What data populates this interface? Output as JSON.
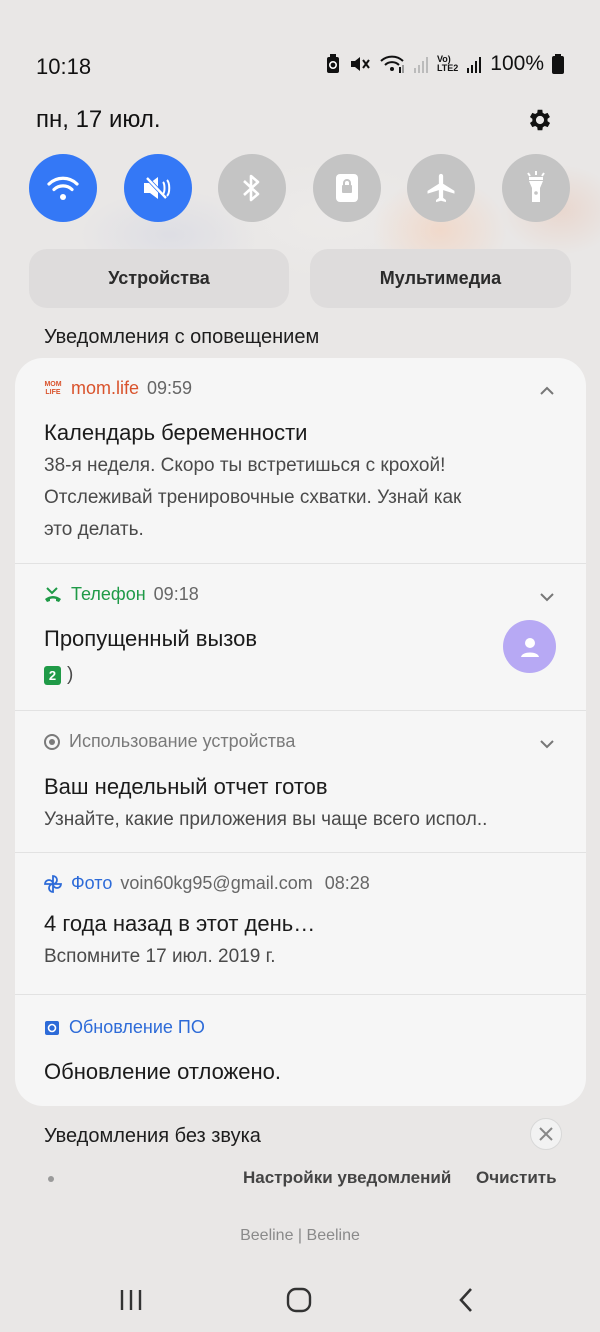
{
  "status_bar": {
    "time": "10:18",
    "battery": "100%",
    "lte_label_top": "Vo)",
    "lte_label_bottom": "LTE2"
  },
  "date": "пн, 17 июл.",
  "quick_toggles": [
    {
      "name": "wifi",
      "state": "on"
    },
    {
      "name": "sound-mute",
      "state": "on"
    },
    {
      "name": "bluetooth",
      "state": "off"
    },
    {
      "name": "rotation-lock",
      "state": "off"
    },
    {
      "name": "airplane-mode",
      "state": "off"
    },
    {
      "name": "flashlight",
      "state": "off"
    }
  ],
  "pills": {
    "devices": "Устройства",
    "media": "Мультимедиа"
  },
  "alerting_section_title": "Уведомления с оповещением",
  "notifications": [
    {
      "app_icon_text": "MOM LIFE",
      "app": "mom.life",
      "time": "09:59",
      "title": "Календарь беременности",
      "body_lines": [
        "38-я неделя. Скоро ты встретишься с крохой!",
        "Отслеживай тренировочные схватки. Узнай как",
        "это делать."
      ],
      "expanded": true,
      "accent": "#d9532c"
    },
    {
      "app": "Телефон",
      "time": "09:18",
      "title": "Пропущенный вызов",
      "sim_badge": "2",
      "body": ")",
      "accent": "#1f9a47"
    },
    {
      "app": "Использование устройства",
      "title": "Ваш недельный отчет готов",
      "body": "Узнайте, какие приложения вы чаще всего испол..",
      "accent": "#7a7a7a"
    },
    {
      "app": "Фото",
      "account": "voin60kg95@gmail.com",
      "time": "08:28",
      "title": "4 года назад в этот день…",
      "body": "Вспомните 17 июл. 2019 г.",
      "accent": "#2d6bd8"
    },
    {
      "app": "Обновление ПО",
      "title": "Обновление отложено.",
      "accent": "#2d6bd8"
    }
  ],
  "silent_section_title": "Уведомления без звука",
  "actions": {
    "settings": "Настройки уведомлений",
    "clear": "Очистить"
  },
  "carrier": "Beeline | Beeline",
  "colors": {
    "toggle_on": "#3478f6",
    "toggle_off": "#c4c4c4",
    "card": "#f6f6f6",
    "avatar": "#b7a9f4"
  }
}
